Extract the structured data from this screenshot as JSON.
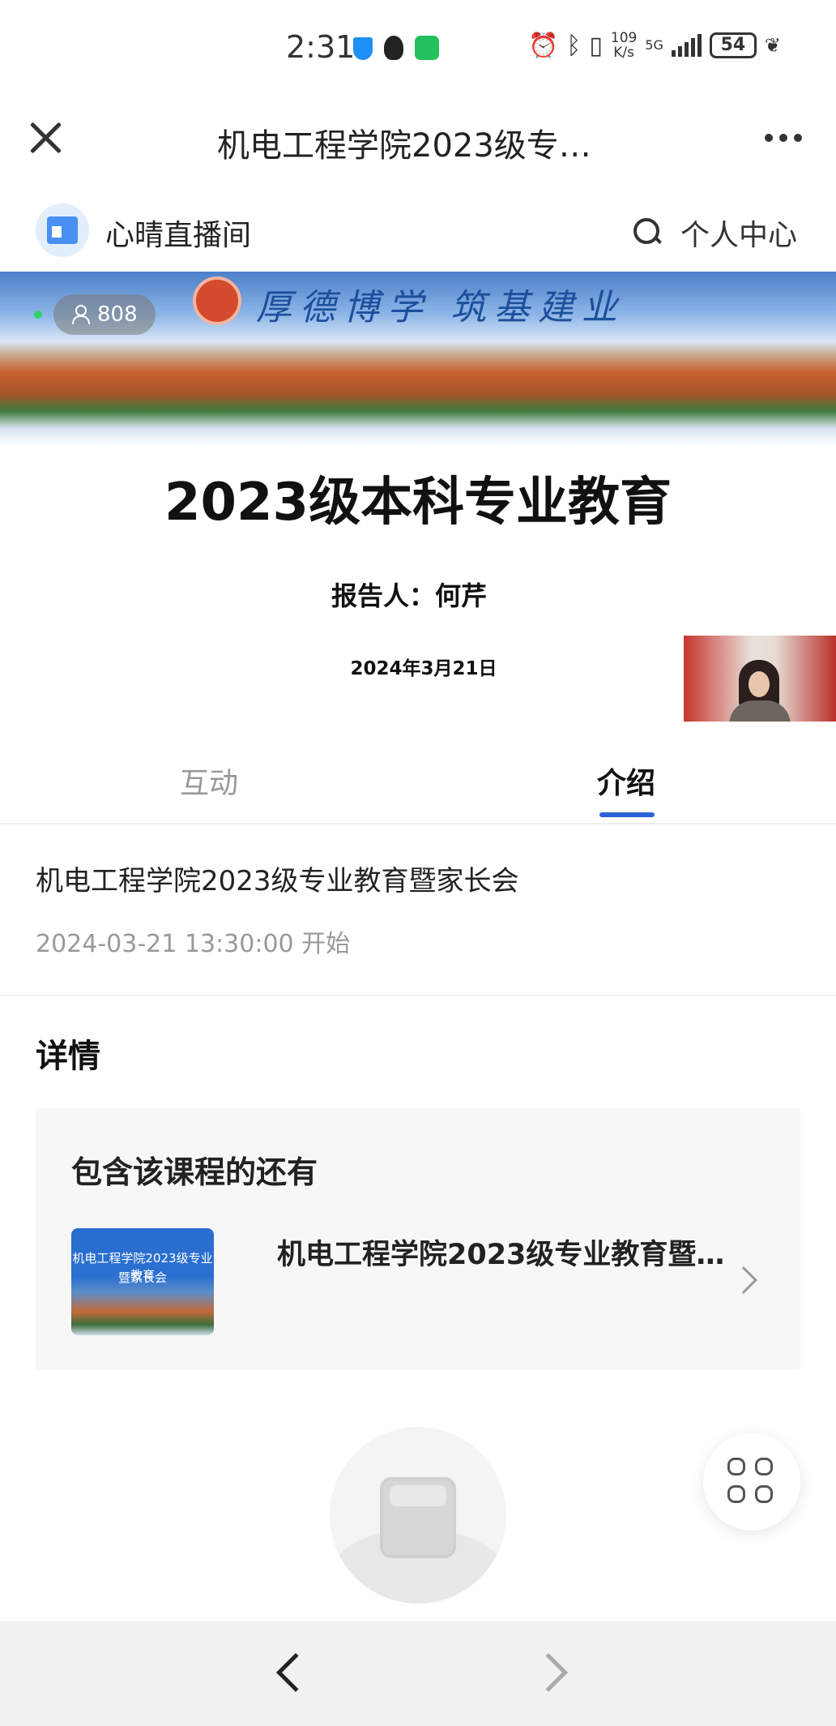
{
  "status_bar": {
    "time": "2:31",
    "app_icons": [
      "shield-icon",
      "qq-icon",
      "wechat-icon"
    ],
    "net_speed_value": "109",
    "net_speed_unit": "K/s",
    "network": "5G",
    "battery": "54"
  },
  "title_bar": {
    "title": "机电工程学院2023级专…"
  },
  "channel": {
    "name": "心晴直播间",
    "personal_center_label": "个人中心"
  },
  "video": {
    "viewer_count": "808",
    "banner_motto": "厚德博学 筑基建业",
    "slide_title": "2023级本科专业教育",
    "slide_reporter": "报告人：何芹",
    "slide_date": "2024年3月21日"
  },
  "tabs": [
    {
      "label": "互动",
      "active": false
    },
    {
      "label": "介绍",
      "active": true
    }
  ],
  "event": {
    "title": "机电工程学院2023级专业教育暨家长会",
    "start_time": "2024-03-21 13:30:00 开始"
  },
  "details": {
    "heading": "详情"
  },
  "related": {
    "heading": "包含该课程的还有",
    "items": [
      {
        "title": "机电工程学院2023级专业教育暨…",
        "thumb_line1": "机电工程学院2023级专业教育",
        "thumb_line2": "暨家长会"
      }
    ]
  },
  "colors": {
    "accent": "#2b62d9",
    "muted_text": "#999999",
    "live_dot": "#2fd36a"
  }
}
